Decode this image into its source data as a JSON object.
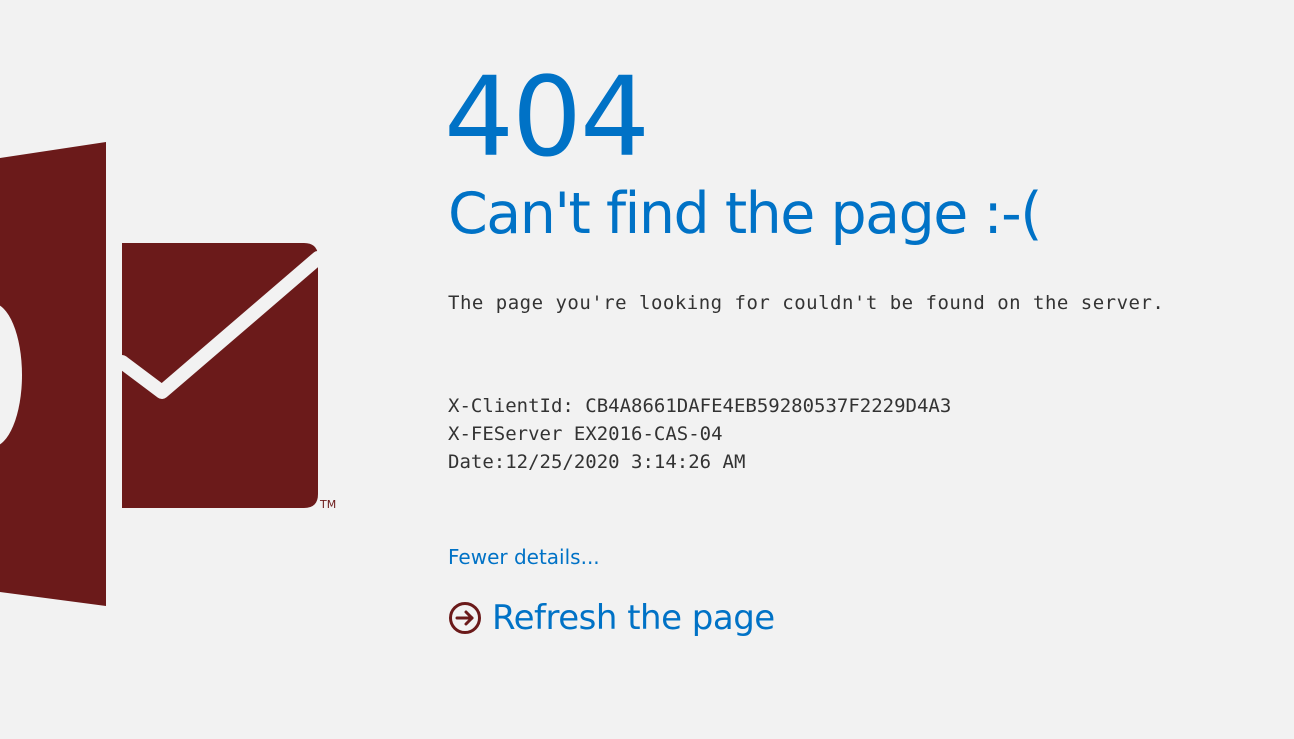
{
  "error": {
    "code": "404",
    "headline": "Can't find the page :-(",
    "message": "The page you're looking for couldn't be found on the server."
  },
  "details": [
    "X-ClientId: CB4A8661DAFE4EB59280537F2229D4A3",
    "X-FEServer EX2016-CAS-04",
    "Date:12/25/2020 3:14:26 AM"
  ],
  "links": {
    "fewer_details": "Fewer details...",
    "refresh": "Refresh the page"
  },
  "logo": {
    "trademark": "TM",
    "icon": "outlook-logo-icon"
  },
  "colors": {
    "accent": "#0072c6",
    "logo": "#6b1a1a",
    "background": "#f2f2f2"
  }
}
